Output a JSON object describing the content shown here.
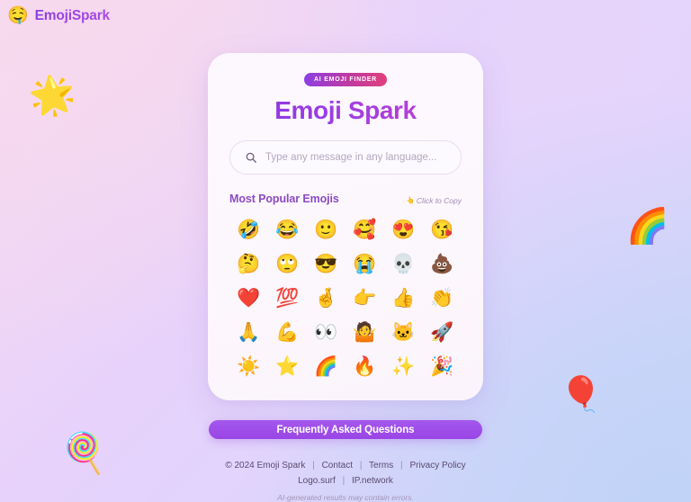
{
  "brand": {
    "emoji": "🤤",
    "emoji_name": "drooling-face",
    "name": "EmojiSpark",
    "accent_color": "#9b45e8"
  },
  "background": {
    "gradient_from": "#f8dbef",
    "gradient_mid": "#e6d4fb",
    "gradient_to": "#c6d5f8",
    "decorations": [
      {
        "name": "glowing-star",
        "emoji": "🌟"
      },
      {
        "name": "rainbow",
        "emoji": "🌈"
      },
      {
        "name": "balloon",
        "emoji": "🎈"
      },
      {
        "name": "lollipop",
        "emoji": "🍭"
      }
    ]
  },
  "card": {
    "badge": "AI EMOJI FINDER",
    "title": "Emoji Spark",
    "title_gradient_from": "#8a36dd",
    "title_gradient_to": "#bb45cd"
  },
  "search": {
    "icon": "search-icon",
    "value": "",
    "placeholder": "Type any message in any language..."
  },
  "popular": {
    "heading": "Most Popular Emojis",
    "copy_hint": "Click to Copy",
    "copy_hint_icon": "👆",
    "rows": [
      [
        {
          "emoji": "🤣",
          "name": "rolling-on-the-floor-laughing"
        },
        {
          "emoji": "😂",
          "name": "face-with-tears-of-joy"
        },
        {
          "emoji": "🙂",
          "name": "slightly-smiling-face"
        },
        {
          "emoji": "🥰",
          "name": "smiling-face-with-hearts"
        },
        {
          "emoji": "😍",
          "name": "smiling-face-with-heart-eyes"
        },
        {
          "emoji": "😘",
          "name": "face-blowing-a-kiss"
        }
      ],
      [
        {
          "emoji": "🤔",
          "name": "thinking-face"
        },
        {
          "emoji": "🙄",
          "name": "face-with-rolling-eyes"
        },
        {
          "emoji": "😎",
          "name": "smiling-face-with-sunglasses"
        },
        {
          "emoji": "😭",
          "name": "loudly-crying-face"
        },
        {
          "emoji": "💀",
          "name": "skull"
        },
        {
          "emoji": "💩",
          "name": "pile-of-poo"
        }
      ],
      [
        {
          "emoji": "❤️",
          "name": "red-heart"
        },
        {
          "emoji": "💯",
          "name": "hundred-points"
        },
        {
          "emoji": "🤞",
          "name": "crossed-fingers"
        },
        {
          "emoji": "👉",
          "name": "backhand-index-pointing-right"
        },
        {
          "emoji": "👍",
          "name": "thumbs-up"
        },
        {
          "emoji": "👏",
          "name": "clapping-hands"
        }
      ],
      [
        {
          "emoji": "🙏",
          "name": "folded-hands"
        },
        {
          "emoji": "💪",
          "name": "flexed-biceps"
        },
        {
          "emoji": "👀",
          "name": "eyes"
        },
        {
          "emoji": "🤷",
          "name": "person-shrugging"
        },
        {
          "emoji": "🐱",
          "name": "cat-face"
        },
        {
          "emoji": "🚀",
          "name": "rocket"
        }
      ],
      [
        {
          "emoji": "☀️",
          "name": "sun"
        },
        {
          "emoji": "⭐",
          "name": "star"
        },
        {
          "emoji": "🌈",
          "name": "rainbow"
        },
        {
          "emoji": "🔥",
          "name": "fire"
        },
        {
          "emoji": "✨",
          "name": "sparkles"
        },
        {
          "emoji": "🎉",
          "name": "party-popper"
        }
      ]
    ]
  },
  "faq": {
    "label": "Frequently Asked Questions",
    "color": "#9a45e6"
  },
  "footer": {
    "copyright": "© 2024 Emoji Spark",
    "links_row1": [
      "Contact",
      "Terms",
      "Privacy Policy"
    ],
    "links_row2": [
      "Logo.surf",
      "IP.network"
    ],
    "separator": "|",
    "disclaimer": "AI-generated results may contain errors."
  }
}
